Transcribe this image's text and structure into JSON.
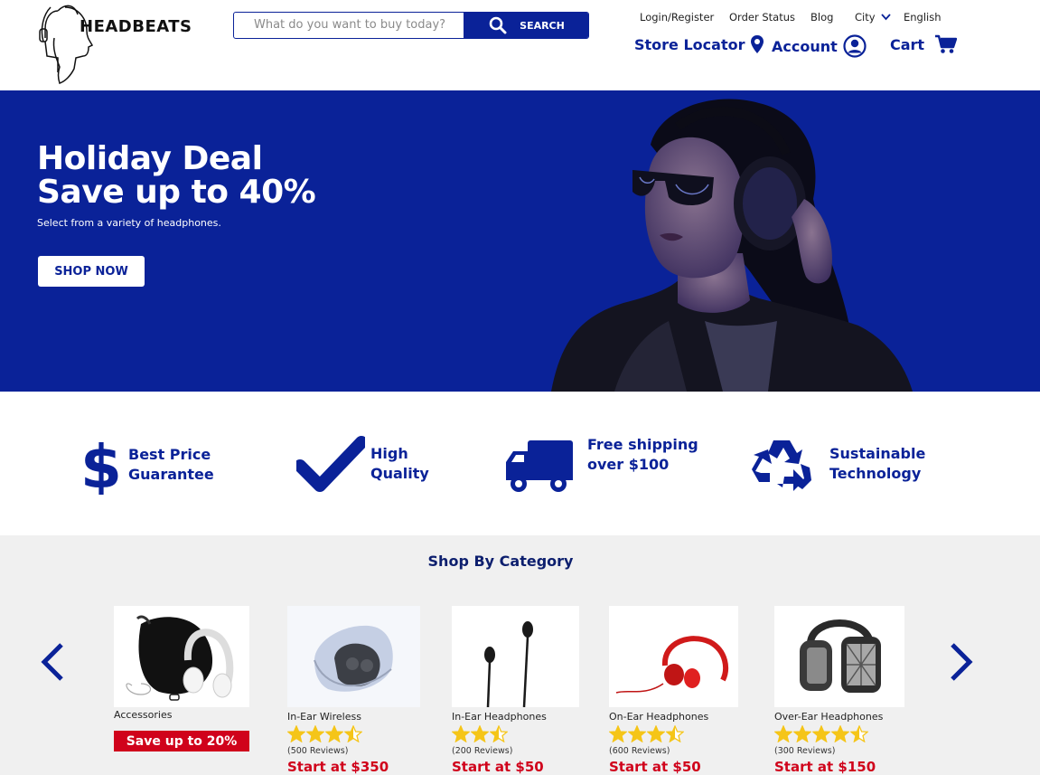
{
  "header": {
    "logo_text": "HEADBEATS",
    "search": {
      "placeholder": "What do you want to buy today?",
      "button_label": "SEARCH"
    },
    "top_links": {
      "login": "Login/Register",
      "order_status": "Order Status",
      "blog": "Blog",
      "city": "City",
      "language": "English"
    },
    "main_links": {
      "store_locator": "Store Locator",
      "account": "Account",
      "cart": "Cart"
    }
  },
  "hero": {
    "title_line1": "Holiday Deal",
    "title_line2": "Save up to 40%",
    "subtitle": "Select from a variety of headphones.",
    "cta": "SHOP NOW"
  },
  "features": [
    {
      "line1": "Best Price",
      "line2": "Guarantee",
      "icon": "dollar-icon"
    },
    {
      "line1": "High",
      "line2": "Quality",
      "icon": "checkmark-icon"
    },
    {
      "line1": "Free shipping",
      "line2": "over $100",
      "icon": "truck-icon"
    },
    {
      "line1": "Sustainable",
      "line2": "Technology",
      "icon": "recycle-icon"
    }
  ],
  "category": {
    "title": "Shop By Category",
    "items": [
      {
        "name": "Accessories",
        "badge": "Save up to 20%"
      },
      {
        "name": "In-Ear Wireless",
        "rating": 3.5,
        "reviews": "(500 Reviews)",
        "price": "Start at $350"
      },
      {
        "name": "In-Ear Headphones",
        "rating": 2.5,
        "reviews": "(200 Reviews)",
        "price": "Start at $50"
      },
      {
        "name": "On-Ear Headphones",
        "rating": 3.5,
        "reviews": "(600 Reviews)",
        "price": "Start at $50"
      },
      {
        "name": "Over-Ear Headphones",
        "rating": 4.5,
        "reviews": "(300 Reviews)",
        "price": "Start at $150"
      }
    ]
  },
  "colors": {
    "brand_blue": "#0a2298",
    "sale_red": "#d0021b",
    "star_yellow": "#f5c518",
    "category_bg": "#f0f0f0"
  }
}
